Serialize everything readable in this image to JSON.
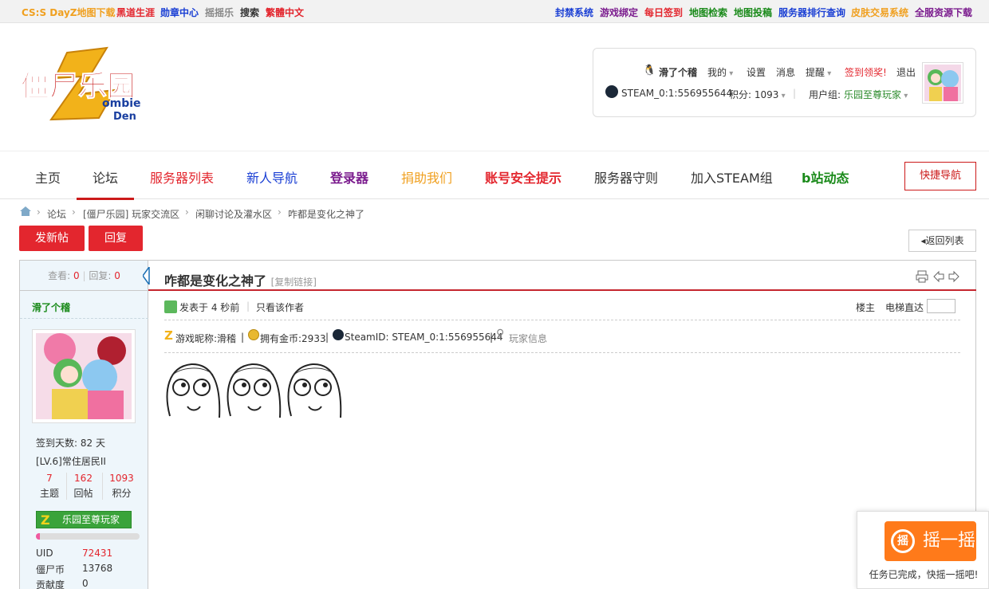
{
  "toplinks": {
    "left": [
      "CS:S DayZ地图下载",
      "黑道生涯",
      "勋章中心",
      "摇摇乐",
      "搜索",
      "繁體中文"
    ],
    "right": [
      "封禁系统",
      "游戏绑定",
      "每日签到",
      "地图检索",
      "地图投稿",
      "服务器排行查询",
      "皮肤交易系统",
      "全服资源下载"
    ]
  },
  "colors": {
    "accent": "#e3262e",
    "brand": "#cc1a1a",
    "group": "#2a8a2a",
    "nav_red": "#e3262e",
    "nav_blue": "#1a3fd4",
    "nav_purple": "#7b1c8e",
    "nav_orange": "#f0a020",
    "nav_green": "#1a8a1a"
  },
  "logo": {
    "text_cn": "僵尸乐园",
    "text_en_1": "ombie",
    "text_en_2": "Den",
    "letter": "Z"
  },
  "user": {
    "name": "滑了个稽",
    "mine": "我的",
    "settings": "设置",
    "messages": "消息",
    "remind": "提醒",
    "signin": "签到领奖!",
    "logout": "退出",
    "steam": "STEAM_0:1:556955644",
    "points": "积分: 1093",
    "group_label": "用户组:",
    "group": "乐园至尊玩家"
  },
  "nav": {
    "items": [
      "主页",
      "论坛",
      "服务器列表",
      "新人导航",
      "登录器",
      "捐助我们",
      "账号安全提示",
      "服务器守则",
      "加入STEAM组",
      "b站动态"
    ],
    "quick": "快捷导航"
  },
  "breadcrumb": [
    "论坛",
    "[僵尸乐园] 玩家交流区",
    "闲聊讨论及灌水区",
    "咋都是变化之神了"
  ],
  "actions": {
    "new_post": "发新帖",
    "reply": "回复",
    "back": "返回列表"
  },
  "thread": {
    "views_label": "查看:",
    "views": "0",
    "replies_label": "回复:",
    "replies": "0",
    "title": "咋都是变化之神了",
    "copy_link": "[复制链接]",
    "posted": "发表于 4 秒前",
    "only_author": "只看该作者",
    "floor": "楼主",
    "elevator": "电梯直达",
    "nickname": "游戏昵称:滑稽",
    "gold": "拥有金币:2933",
    "steamid": "SteamID: STEAM_0:1:556955644",
    "player_info": "玩家信息"
  },
  "author": {
    "name": "滑了个稽",
    "signin_days": "签到天数: 82 天",
    "level": "[LV.6]常住居民II",
    "topics": "7",
    "topics_label": "主题",
    "posts": "162",
    "posts_label": "回帖",
    "score": "1093",
    "score_label": "积分",
    "group_badge": "乐园至尊玩家",
    "uid_label": "UID",
    "uid": "72431",
    "coin_label": "僵尸币",
    "coin": "13768",
    "contrib_label": "贡献度",
    "contrib": "0"
  },
  "shake": {
    "button": "摇一摇",
    "icon": "摇",
    "notice": "任务已完成，快摇一摇吧!"
  }
}
